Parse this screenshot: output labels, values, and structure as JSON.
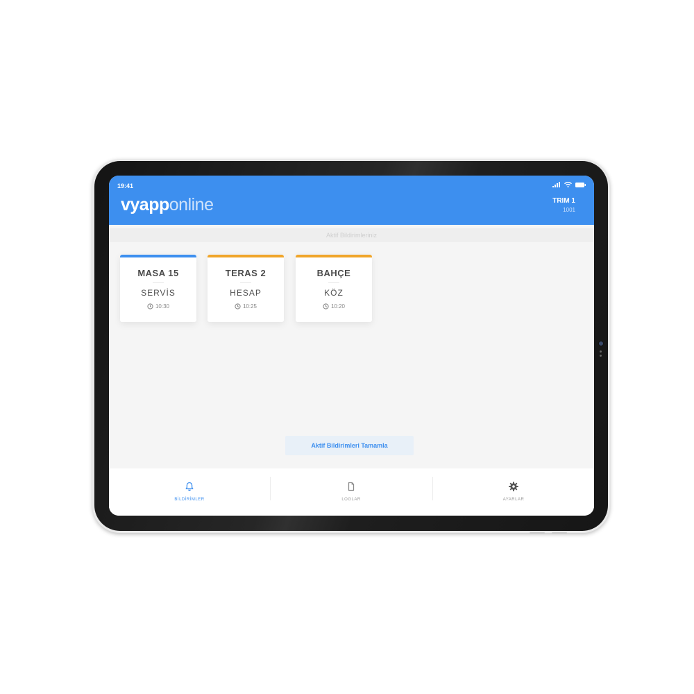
{
  "status_bar": {
    "time": "19:41",
    "icons": [
      "signal-icon",
      "wifi-icon",
      "battery-icon"
    ]
  },
  "header": {
    "logo_bold": "vyapp",
    "logo_light": "online",
    "venue_name": "TRIM 1",
    "venue_code": "1001"
  },
  "section_title": "Aktif Bildirimleriniz",
  "notifications": [
    {
      "title": "MASA 15",
      "type": "SERVİS",
      "time": "10:30",
      "accent": "#3d8fef"
    },
    {
      "title": "TERAS 2",
      "type": "HESAP",
      "time": "10:25",
      "accent": "#f0a52a"
    },
    {
      "title": "BAHÇE",
      "type": "KÖZ",
      "time": "10:20",
      "accent": "#f0a52a"
    }
  ],
  "complete_button": "Aktif Bildirimleri Tamamla",
  "nav": [
    {
      "label": "BİLDİRİMLER",
      "icon": "bell-icon",
      "active": true
    },
    {
      "label": "LOGLAR",
      "icon": "document-icon",
      "active": false
    },
    {
      "label": "AYARLAR",
      "icon": "gear-icon",
      "active": false
    }
  ],
  "colors": {
    "primary": "#3d8fef",
    "warning": "#f0a52a",
    "background": "#f5f5f5"
  }
}
